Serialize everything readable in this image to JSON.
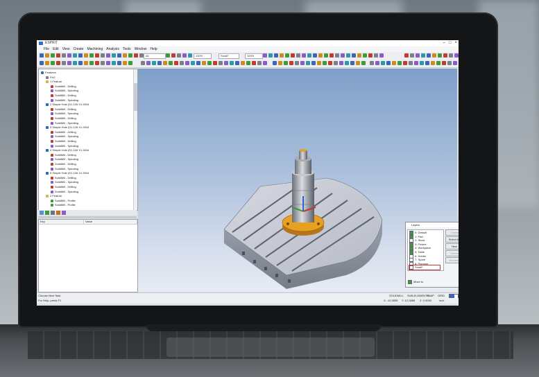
{
  "window": {
    "title": "ESPRIT",
    "controls": [
      "–",
      "□",
      "×"
    ]
  },
  "menu": [
    "File",
    "Edit",
    "View",
    "Create",
    "Machining",
    "Analysis",
    "Tools",
    "Window",
    "Help"
  ],
  "toolbar": {
    "combo_1": "All",
    "combo_2": "100%",
    "combo_3": "Small*",
    "combo_4": "100%"
  },
  "tree": {
    "items": [
      {
        "label": "Features",
        "level": 0,
        "icon": "features-icon"
      },
      {
        "label": "Fix2",
        "level": 1,
        "icon": "fixture-icon"
      },
      {
        "label": "1 Feature",
        "level": 1,
        "icon": "folder-icon"
      },
      {
        "label": "SolidMill - Drilling",
        "level": 2,
        "icon": "drill-op-icon"
      },
      {
        "label": "SolidMill - Spiraling",
        "level": 2,
        "icon": "spiral-op-icon"
      },
      {
        "label": "SolidMill - Drilling",
        "level": 2,
        "icon": "drill-op-icon"
      },
      {
        "label": "SolidMill - Spiraling",
        "level": 2,
        "icon": "spiral-op-icon"
      },
      {
        "label": "2 Simple Hole (D1.126 X1.3016",
        "level": 1,
        "icon": "hole-feature-icon"
      },
      {
        "label": "SolidMill - Drilling",
        "level": 2,
        "icon": "drill-op-icon"
      },
      {
        "label": "SolidMill - Spiraling",
        "level": 2,
        "icon": "spiral-op-icon"
      },
      {
        "label": "SolidMill - Drilling",
        "level": 2,
        "icon": "drill-op-icon"
      },
      {
        "label": "SolidMill - Spiraling",
        "level": 2,
        "icon": "spiral-op-icon"
      },
      {
        "label": "3 Simple Hole (D1.126 X1.3016",
        "level": 1,
        "icon": "hole-feature-icon"
      },
      {
        "label": "SolidMill - Drilling",
        "level": 2,
        "icon": "drill-op-icon"
      },
      {
        "label": "SolidMill - Spiraling",
        "level": 2,
        "icon": "spiral-op-icon"
      },
      {
        "label": "SolidMill - Drilling",
        "level": 2,
        "icon": "drill-op-icon"
      },
      {
        "label": "SolidMill - Spiraling",
        "level": 2,
        "icon": "spiral-op-icon"
      },
      {
        "label": "4 Simple Hole (D1.126 X1.3016",
        "level": 1,
        "icon": "hole-feature-icon"
      },
      {
        "label": "SolidMill - Drilling",
        "level": 2,
        "icon": "drill-op-icon"
      },
      {
        "label": "SolidMill - Spiraling",
        "level": 2,
        "icon": "spiral-op-icon"
      },
      {
        "label": "SolidMill - Drilling",
        "level": 2,
        "icon": "drill-op-icon"
      },
      {
        "label": "SolidMill - Spiraling",
        "level": 2,
        "icon": "spiral-op-icon"
      },
      {
        "label": "5 Simple Hole (D1.126 X1.3016",
        "level": 1,
        "icon": "hole-feature-icon"
      },
      {
        "label": "SolidMill - Drilling",
        "level": 2,
        "icon": "drill-op-icon"
      },
      {
        "label": "SolidMill - Spiraling",
        "level": 2,
        "icon": "spiral-op-icon"
      },
      {
        "label": "SolidMill - Drilling",
        "level": 2,
        "icon": "drill-op-icon"
      },
      {
        "label": "SolidMill - Spiraling",
        "level": 2,
        "icon": "spiral-op-icon"
      },
      {
        "label": "2 Feature",
        "level": 1,
        "icon": "folder-icon"
      },
      {
        "label": "SolidMill - Profile",
        "level": 2,
        "icon": "profile-op-icon"
      },
      {
        "label": "SolidMill - Profile",
        "level": 2,
        "icon": "profile-op-icon"
      }
    ]
  },
  "properties": {
    "col_key": "Key",
    "col_value": "Value"
  },
  "layers_dialog": {
    "title": "Layers",
    "items": [
      {
        "label": "0: Default",
        "checked": true
      },
      {
        "label": "1: Part",
        "checked": true
      },
      {
        "label": "2: Stock",
        "checked": false
      },
      {
        "label": "3: Fixture",
        "checked": true
      },
      {
        "label": "4: Workpiece",
        "checked": true
      },
      {
        "label": "5: Table",
        "checked": true
      },
      {
        "label": "6: Holder",
        "checked": false
      },
      {
        "label": "7: Spare",
        "checked": false
      },
      {
        "label": "8: Purpose",
        "checked": false
      },
      {
        "label": "Small*",
        "checked": false,
        "selected": true
      }
    ],
    "buttons": {
      "create": "Create",
      "select_all": "Select All",
      "new": "New",
      "delete": "Delete",
      "rename": "Rename"
    },
    "footer": "Move to"
  },
  "status": {
    "hint": "Choose Next Task",
    "help": "For Help, press F1",
    "solidmill": "SOLIDMILL",
    "sub_elements": "SUB-ELEMENTS",
    "snap": "SNAP",
    "grid": "GRID",
    "coord_x": "X: -11.5836",
    "coord_y": "Y: 12.0888",
    "coord_z": "Z: 0.0000",
    "units": "inch",
    "zoom_pct": "100",
    "progress": 0.6
  },
  "colors": {
    "viewport_top": "#7f9fc8",
    "part_gray": "#c9ccd6",
    "fixture_orange": "#e8a020",
    "progress": "#3a66b8"
  }
}
